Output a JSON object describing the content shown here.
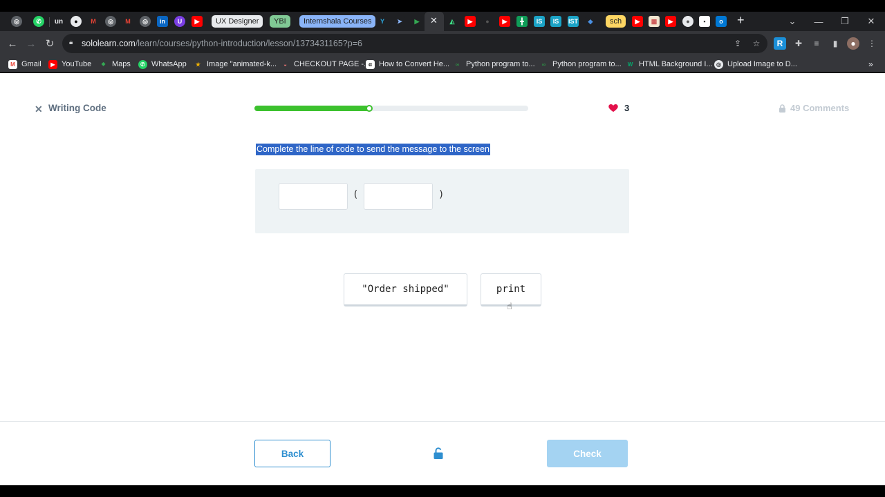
{
  "browser": {
    "tab_groups": [
      {
        "label": "UX Designer",
        "color": "#e8eaed"
      },
      {
        "label": "YBI",
        "color": "#81c995"
      },
      {
        "label": "Internshala Courses",
        "color": "#8ab4f8"
      },
      {
        "label": "sch",
        "color": "#fdd663"
      }
    ],
    "address": {
      "host": "sololearn.com",
      "path": "/learn/courses/python-introduction/lesson/1373431165?p=6"
    },
    "bookmarks": [
      "Gmail",
      "YouTube",
      "Maps",
      "WhatsApp",
      "Image \"animated-k...",
      "CHECKOUT PAGE -...",
      "How to Convert He...",
      "Python program to...",
      "Python program to...",
      "HTML Background I...",
      "Upload Image to D..."
    ],
    "bookmarks_more": "»",
    "new_tab": "+"
  },
  "lesson": {
    "close_glyph": "✕",
    "title": "Writing Code",
    "progress": 0.42,
    "hearts": "3",
    "comments": "49 Comments",
    "question": "Complete the line of code to send the message to the screen",
    "code": {
      "open_paren": "(",
      "close_paren": ")"
    },
    "choices": [
      "\"Order shipped\"",
      "print"
    ],
    "back_label": "Back",
    "check_label": "Check"
  },
  "colors": {
    "progress": "#3cc12e",
    "heart": "#e3114b",
    "primary": "#2f8fd0",
    "check_disabled": "#a4d3f2",
    "selection": "#2f66c7"
  }
}
